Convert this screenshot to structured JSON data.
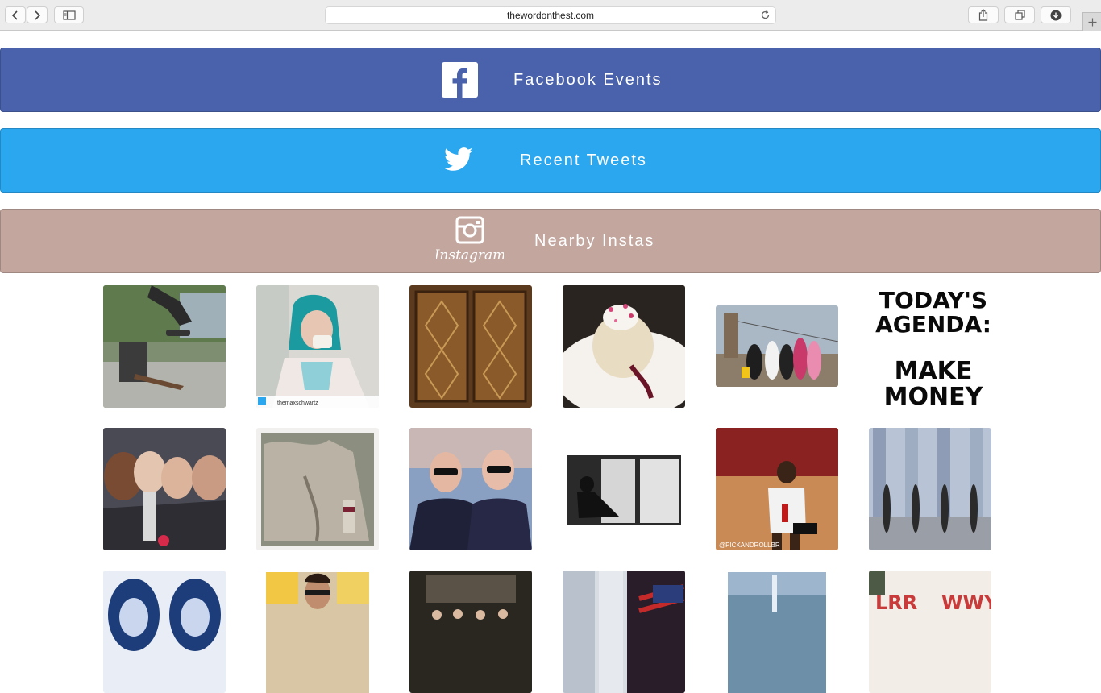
{
  "browser": {
    "url": "thewordonthest.com",
    "icons": {
      "back": "chevron-left-icon",
      "forward": "chevron-right-icon",
      "sidebar": "sidebar-icon",
      "reload": "reload-icon",
      "share": "share-icon",
      "tabs": "tabs-overview-icon",
      "downloads": "download-icon",
      "new_tab": "plus-icon"
    }
  },
  "sections": {
    "facebook": {
      "label": "Facebook Events",
      "color": "#4a62ab",
      "icon": "facebook-icon"
    },
    "twitter": {
      "label": "Recent Tweets",
      "color": "#2ba7ef",
      "icon": "twitter-bird-icon"
    },
    "instagram": {
      "label": "Nearby Instas",
      "color": "#c3a79f",
      "icon": "instagram-icon",
      "icon_text": "Instagram"
    }
  },
  "photos": {
    "row1": [
      {
        "subject": "skateboarder",
        "caption": ""
      },
      {
        "subject": "woman-teal-hair-drinking",
        "caption": "themaxschwartz"
      },
      {
        "subject": "ornate-wooden-door",
        "caption": ""
      },
      {
        "subject": "dessert-plate",
        "caption": ""
      },
      {
        "subject": "group-brooklyn-bridge",
        "caption": ""
      },
      {
        "subject": "text-graphic",
        "text_lines": [
          "TODAY'S",
          "AGENDA:",
          "MAKE",
          "MONEY"
        ]
      }
    ],
    "row2": [
      {
        "subject": "friends-selfie",
        "caption": ""
      },
      {
        "subject": "jacket-closeup",
        "caption": ""
      },
      {
        "subject": "two-guys-sunglasses",
        "caption": ""
      },
      {
        "subject": "woman-window-silhouette",
        "caption": ""
      },
      {
        "subject": "basketball-player",
        "caption": "@PICKANDROLLBR"
      },
      {
        "subject": "mirrored-street-photo",
        "caption": ""
      }
    ],
    "row3": [
      {
        "subject": "mirrored-portrait",
        "caption": ""
      },
      {
        "subject": "man-with-sunglasses",
        "caption": ""
      },
      {
        "subject": "group-indoor",
        "caption": ""
      },
      {
        "subject": "buildings-american-flag",
        "caption": ""
      },
      {
        "subject": "city-skyline-aerial",
        "caption": ""
      },
      {
        "subject": "red-wall-lettering",
        "text_lines": [
          "LRR",
          "WWY"
        ]
      }
    ]
  }
}
